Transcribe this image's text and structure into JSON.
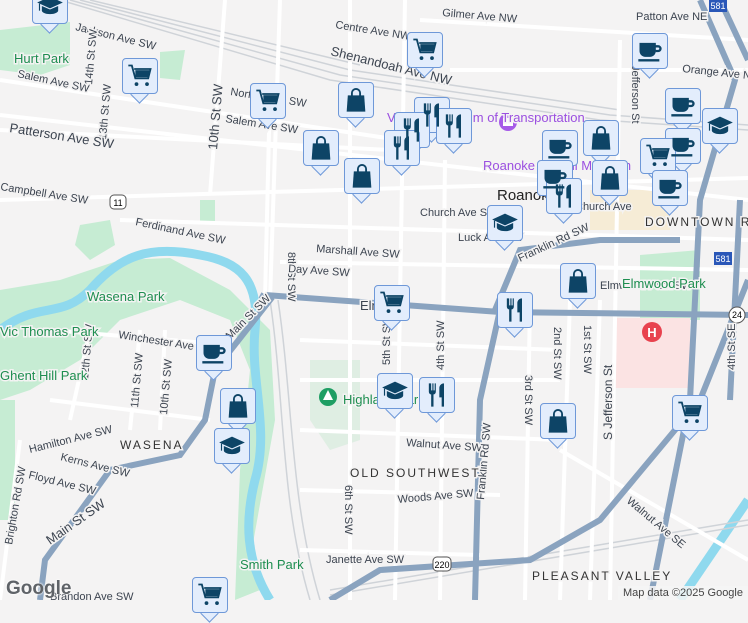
{
  "map": {
    "streets": [
      "Jackson Ave SW",
      "Salem Ave SW",
      "14th St SW",
      "13th St SW",
      "Patterson Ave SW",
      "Campbell Ave SW",
      "Ferdinand Ave SW",
      "10th St SW",
      "8th St SW",
      "Norfolk Ave SW",
      "Salem Ave SW",
      "Marshall Ave SW",
      "Day Ave SW",
      "Shenandoah Ave NW",
      "Centre Ave NW",
      "Gilmer Ave NW",
      "Patton Ave NE",
      "Church Ave SW",
      "Luck Ave SW",
      "Franklin Rd SW",
      "Elm Ave",
      "Winchester Ave",
      "Main St SW",
      "12th St SW",
      "11th St SW",
      "10th St SW",
      "Hamilton Ave SW",
      "Kerns Ave SW",
      "Floyd Ave SW",
      "Brighton Rd SW",
      "Main St SW",
      "5th St SW",
      "4th St SW",
      "3rd St SW",
      "2nd St SW",
      "1st St SW",
      "S Jefferson St",
      "Walnut Ave SW",
      "Woods Ave SW",
      "6th St SW",
      "Janette Ave SW",
      "Walnut Ave SE",
      "Franklin Rd SW",
      "Brandon Ave SW",
      "4th St SE",
      "Orange Ave NE",
      "Jefferson St",
      "Church Ave",
      "Elmwood Park SW"
    ],
    "parks": [
      "Hurt Park",
      "Wasena Park",
      "Vic Thomas Park",
      "Ghent Hill Park",
      "Smith Park",
      "Elmwood Park",
      "Highland Park"
    ],
    "neighborhoods": [
      "DOWNTOWN ROANOKE",
      "WASENA",
      "OLD SOUTHWEST",
      "PLEASANT VALLEY"
    ],
    "city": "Roanoke",
    "pois": [
      "Virginia Museum of Transportation",
      "Roanoke Pinball Museum"
    ],
    "route_shields": [
      "11",
      "220",
      "581",
      "581",
      "24"
    ],
    "hospital": "H"
  },
  "markers": [
    "school",
    "cart",
    "cart",
    "bag",
    "bag",
    "bag",
    "cart",
    "restaurant",
    "restaurant",
    "restaurant",
    "restaurant",
    "coffee",
    "coffee",
    "bag",
    "coffee",
    "bag",
    "restaurant",
    "coffee",
    "coffee",
    "school",
    "cart",
    "coffee",
    "school",
    "bag",
    "cart",
    "restaurant",
    "coffee",
    "bag",
    "school",
    "school",
    "restaurant",
    "bag",
    "cart",
    "cart"
  ],
  "attribution": {
    "logo": "Google",
    "text": "Map data ©2025 Google"
  },
  "colors": {
    "marker_fill": "#e3edfc",
    "marker_border": "#6e98d8",
    "icon": "#0d4466",
    "highway": "#8aa3bf",
    "park": "#c6ecd3",
    "river": "#8fd9ee"
  }
}
